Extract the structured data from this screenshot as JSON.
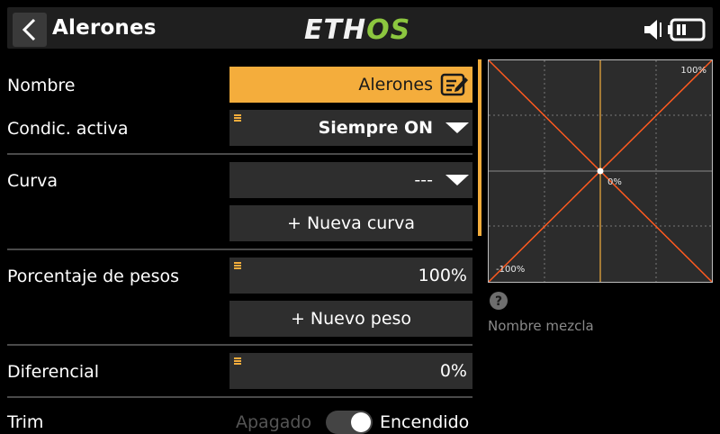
{
  "header": {
    "title": "Alerones",
    "logo_left": "ETH",
    "logo_right": "OS"
  },
  "rows": {
    "name": {
      "label": "Nombre",
      "value": "Alerones"
    },
    "active_condition": {
      "label": "Condic. activa",
      "value": "Siempre ON"
    },
    "curve": {
      "label": "Curva",
      "value": "---",
      "new_curve_label": "+ Nueva curva"
    },
    "weight": {
      "label": "Porcentaje de pesos",
      "value": "100%",
      "new_weight_label": "+ Nuevo peso"
    },
    "differential": {
      "label": "Diferencial",
      "value": "0%"
    },
    "trim": {
      "label": "Trim",
      "off_label": "Apagado",
      "on_label": "Encendido",
      "state": "on"
    }
  },
  "graph": {
    "top_right_label": "100%",
    "center_label": "0%",
    "bottom_left_label": "-100%",
    "curve_color": "#ff5a1f",
    "cursor_color": "#f4ad3c"
  },
  "mix_name_label": "Nombre mezcla",
  "colors": {
    "accent": "#f4ad3c",
    "logo_green": "#8cc63f"
  }
}
